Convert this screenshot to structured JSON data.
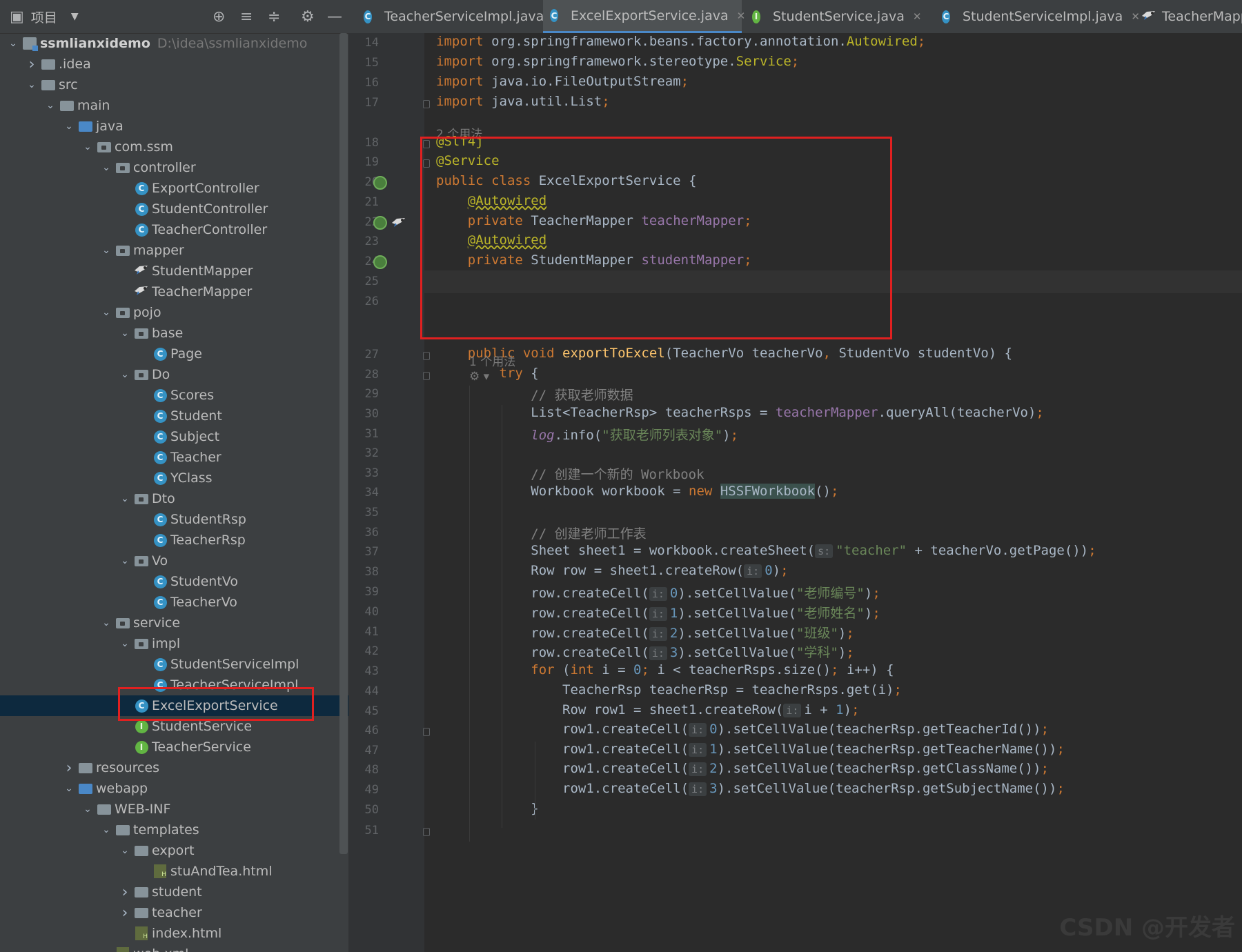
{
  "toolbar": {
    "title": "项目",
    "icons": [
      "locate-icon",
      "expand-all-icon",
      "collapse-all-icon",
      "gear-icon",
      "minimize-icon"
    ]
  },
  "tree": [
    {
      "label": "ssmlianxidemo",
      "hint": "D:\\idea\\ssmlianxidemo",
      "depth": 0,
      "arrow": "down",
      "icon": "project",
      "bold": true
    },
    {
      "label": ".idea",
      "depth": 1,
      "arrow": "right",
      "icon": "folder"
    },
    {
      "label": "src",
      "depth": 1,
      "arrow": "down",
      "icon": "folder"
    },
    {
      "label": "main",
      "depth": 2,
      "arrow": "down",
      "icon": "folder"
    },
    {
      "label": "java",
      "depth": 3,
      "arrow": "down",
      "icon": "folder-blue"
    },
    {
      "label": "com.ssm",
      "depth": 4,
      "arrow": "down",
      "icon": "package"
    },
    {
      "label": "controller",
      "depth": 5,
      "arrow": "down",
      "icon": "package"
    },
    {
      "label": "ExportController",
      "depth": 6,
      "icon": "class"
    },
    {
      "label": "StudentController",
      "depth": 6,
      "icon": "class"
    },
    {
      "label": "TeacherController",
      "depth": 6,
      "icon": "class"
    },
    {
      "label": "mapper",
      "depth": 5,
      "arrow": "down",
      "icon": "package"
    },
    {
      "label": "StudentMapper",
      "depth": 6,
      "icon": "mapper"
    },
    {
      "label": "TeacherMapper",
      "depth": 6,
      "icon": "mapper"
    },
    {
      "label": "pojo",
      "depth": 5,
      "arrow": "down",
      "icon": "package"
    },
    {
      "label": "base",
      "depth": 6,
      "arrow": "down",
      "icon": "package"
    },
    {
      "label": "Page",
      "depth": 7,
      "icon": "class"
    },
    {
      "label": "Do",
      "depth": 6,
      "arrow": "down",
      "icon": "package"
    },
    {
      "label": "Scores",
      "depth": 7,
      "icon": "class"
    },
    {
      "label": "Student",
      "depth": 7,
      "icon": "class"
    },
    {
      "label": "Subject",
      "depth": 7,
      "icon": "class"
    },
    {
      "label": "Teacher",
      "depth": 7,
      "icon": "class"
    },
    {
      "label": "YClass",
      "depth": 7,
      "icon": "class"
    },
    {
      "label": "Dto",
      "depth": 6,
      "arrow": "down",
      "icon": "package"
    },
    {
      "label": "StudentRsp",
      "depth": 7,
      "icon": "class"
    },
    {
      "label": "TeacherRsp",
      "depth": 7,
      "icon": "class"
    },
    {
      "label": "Vo",
      "depth": 6,
      "arrow": "down",
      "icon": "package"
    },
    {
      "label": "StudentVo",
      "depth": 7,
      "icon": "class"
    },
    {
      "label": "TeacherVo",
      "depth": 7,
      "icon": "class"
    },
    {
      "label": "service",
      "depth": 5,
      "arrow": "down",
      "icon": "package"
    },
    {
      "label": "impl",
      "depth": 6,
      "arrow": "down",
      "icon": "package"
    },
    {
      "label": "StudentServiceImpl",
      "depth": 7,
      "icon": "class"
    },
    {
      "label": "TeacherServiceImpl",
      "depth": 7,
      "icon": "class"
    },
    {
      "label": "ExcelExportService",
      "depth": 6,
      "icon": "class",
      "selected": true
    },
    {
      "label": "StudentService",
      "depth": 6,
      "icon": "interface"
    },
    {
      "label": "TeacherService",
      "depth": 6,
      "icon": "interface"
    },
    {
      "label": "resources",
      "depth": 3,
      "arrow": "right",
      "icon": "folder"
    },
    {
      "label": "webapp",
      "depth": 3,
      "arrow": "down",
      "icon": "folder-blue"
    },
    {
      "label": "WEB-INF",
      "depth": 4,
      "arrow": "down",
      "icon": "folder"
    },
    {
      "label": "templates",
      "depth": 5,
      "arrow": "down",
      "icon": "folder"
    },
    {
      "label": "export",
      "depth": 6,
      "arrow": "down",
      "icon": "folder"
    },
    {
      "label": "stuAndTea.html",
      "depth": 7,
      "icon": "html"
    },
    {
      "label": "student",
      "depth": 6,
      "arrow": "right",
      "icon": "folder"
    },
    {
      "label": "teacher",
      "depth": 6,
      "arrow": "right",
      "icon": "folder"
    },
    {
      "label": "index.html",
      "depth": 6,
      "icon": "html"
    },
    {
      "label": "web.xml",
      "depth": 5,
      "icon": "html"
    }
  ],
  "tabs": [
    {
      "label": "TeacherServiceImpl.java",
      "icon": "class"
    },
    {
      "label": "ExcelExportService.java",
      "icon": "class",
      "active": true
    },
    {
      "label": "StudentService.java",
      "icon": "interface"
    },
    {
      "label": "StudentServiceImpl.java",
      "icon": "class"
    },
    {
      "label": "TeacherMapper.java",
      "icon": "mapper"
    }
  ],
  "usages": [
    "2 个用法",
    "1 个用法"
  ],
  "lines": [
    {
      "n": "14",
      "tokens": [
        [
          "kw",
          "import "
        ],
        [
          "",
          "org.springframework.beans.factory.annotation."
        ],
        [
          "ann",
          "Autowired"
        ],
        [
          "kw",
          ";"
        ]
      ]
    },
    {
      "n": "15",
      "tokens": [
        [
          "kw",
          "import "
        ],
        [
          "",
          "org.springframework.stereotype."
        ],
        [
          "ann",
          "Service"
        ],
        [
          "kw",
          ";"
        ]
      ]
    },
    {
      "n": "16",
      "tokens": [
        [
          "kw",
          "import "
        ],
        [
          "",
          "java.io.FileOutputStream"
        ],
        [
          "kw",
          ";"
        ]
      ]
    },
    {
      "n": "17",
      "tokens": [
        [
          "kw",
          "import "
        ],
        [
          "",
          "java.util.List"
        ],
        [
          "kw",
          ";"
        ]
      ]
    },
    {
      "n": "18",
      "tokens": [
        [
          "ann",
          "@Slf4j"
        ]
      ]
    },
    {
      "n": "19",
      "tokens": [
        [
          "ann",
          "@Service"
        ]
      ]
    },
    {
      "n": "20",
      "tokens": [
        [
          "kw",
          "public class "
        ],
        [
          "",
          "ExcelExportService {"
        ]
      ]
    },
    {
      "n": "21",
      "tokens": [
        [
          "",
          "    "
        ],
        [
          "ann wavy",
          "@Autowired"
        ]
      ]
    },
    {
      "n": "22",
      "tokens": [
        [
          "",
          "    "
        ],
        [
          "kw",
          "private "
        ],
        [
          "",
          "TeacherMapper "
        ],
        [
          "fld",
          "teacherMapper"
        ],
        [
          "kw",
          ";"
        ]
      ]
    },
    {
      "n": "23",
      "tokens": [
        [
          "",
          "    "
        ],
        [
          "ann wavy",
          "@Autowired"
        ]
      ]
    },
    {
      "n": "24",
      "tokens": [
        [
          "",
          "    "
        ],
        [
          "kw",
          "private "
        ],
        [
          "",
          "StudentMapper "
        ],
        [
          "fld",
          "studentMapper"
        ],
        [
          "kw",
          ";"
        ]
      ]
    },
    {
      "n": "25",
      "tokens": []
    },
    {
      "n": "26",
      "tokens": []
    },
    {
      "n": "27",
      "tokens": [
        [
          "",
          "    "
        ],
        [
          "kw",
          "public void "
        ],
        [
          "mth",
          "exportToExcel"
        ],
        [
          "",
          "(TeacherVo teacherVo"
        ],
        [
          "kw",
          ", "
        ],
        [
          "",
          "StudentVo studentVo) {"
        ]
      ]
    },
    {
      "n": "28",
      "tokens": [
        [
          "",
          "        "
        ],
        [
          "kw",
          "try "
        ],
        [
          "",
          "{"
        ]
      ]
    },
    {
      "n": "29",
      "tokens": [
        [
          "",
          "            "
        ],
        [
          "cmt",
          "// 获取老师数据"
        ]
      ]
    },
    {
      "n": "30",
      "tokens": [
        [
          "",
          "            List<TeacherRsp> teacherRsps = "
        ],
        [
          "fld",
          "teacherMapper"
        ],
        [
          "",
          ".queryAll(teacherVo)"
        ],
        [
          "kw",
          ";"
        ]
      ]
    },
    {
      "n": "31",
      "tokens": [
        [
          "",
          "            "
        ],
        [
          "fld itl",
          "log"
        ],
        [
          "",
          ".info("
        ],
        [
          "str",
          "\"获取老师列表对象\""
        ],
        [
          "",
          ")"
        ],
        [
          "kw",
          ";"
        ]
      ]
    },
    {
      "n": "32",
      "tokens": []
    },
    {
      "n": "33",
      "tokens": [
        [
          "",
          "            "
        ],
        [
          "cmt",
          "// 创建一个新的 Workbook"
        ]
      ]
    },
    {
      "n": "34",
      "tokens": [
        [
          "",
          "            Workbook workbook = "
        ],
        [
          "kw",
          "new "
        ],
        [
          "hl-bg",
          "HSSFWorkbook"
        ],
        [
          "",
          "()"
        ],
        [
          "kw",
          ";"
        ]
      ]
    },
    {
      "n": "35",
      "tokens": []
    },
    {
      "n": "36",
      "tokens": [
        [
          "",
          "            "
        ],
        [
          "cmt",
          "// 创建老师工作表"
        ]
      ]
    },
    {
      "n": "37",
      "tokens": [
        [
          "",
          "            Sheet sheet1 = workbook.createSheet("
        ],
        [
          "inlay",
          "s:"
        ],
        [
          "str",
          "\"teacher\" "
        ],
        [
          "",
          "+ teacherVo.getPage())"
        ],
        [
          "kw",
          ";"
        ]
      ]
    },
    {
      "n": "38",
      "tokens": [
        [
          "",
          "            Row row = sheet1.createRow("
        ],
        [
          "inlay",
          "i:"
        ],
        [
          "num",
          "0"
        ],
        [
          "",
          ")"
        ],
        [
          "kw",
          ";"
        ]
      ]
    },
    {
      "n": "39",
      "tokens": [
        [
          "",
          "            row.createCell("
        ],
        [
          "inlay",
          "i:"
        ],
        [
          "num",
          "0"
        ],
        [
          "",
          ").setCellValue("
        ],
        [
          "str",
          "\"老师编号\""
        ],
        [
          "",
          ")"
        ],
        [
          "kw",
          ";"
        ]
      ]
    },
    {
      "n": "40",
      "tokens": [
        [
          "",
          "            row.createCell("
        ],
        [
          "inlay",
          "i:"
        ],
        [
          "num",
          "1"
        ],
        [
          "",
          ").setCellValue("
        ],
        [
          "str",
          "\"老师姓名\""
        ],
        [
          "",
          ")"
        ],
        [
          "kw",
          ";"
        ]
      ]
    },
    {
      "n": "41",
      "tokens": [
        [
          "",
          "            row.createCell("
        ],
        [
          "inlay",
          "i:"
        ],
        [
          "num",
          "2"
        ],
        [
          "",
          ").setCellValue("
        ],
        [
          "str",
          "\"班级\""
        ],
        [
          "",
          ")"
        ],
        [
          "kw",
          ";"
        ]
      ]
    },
    {
      "n": "42",
      "tokens": [
        [
          "",
          "            row.createCell("
        ],
        [
          "inlay",
          "i:"
        ],
        [
          "num",
          "3"
        ],
        [
          "",
          ").setCellValue("
        ],
        [
          "str",
          "\"学科\""
        ],
        [
          "",
          ")"
        ],
        [
          "kw",
          ";"
        ]
      ]
    },
    {
      "n": "43",
      "tokens": [
        [
          "",
          "            "
        ],
        [
          "kw",
          "for "
        ],
        [
          "",
          "("
        ],
        [
          "kw",
          "int "
        ],
        [
          "",
          "i = "
        ],
        [
          "num",
          "0"
        ],
        [
          "kw",
          "; "
        ],
        [
          "",
          "i < teacherRsps.size()"
        ],
        [
          "kw",
          "; "
        ],
        [
          "",
          "i++) {"
        ]
      ]
    },
    {
      "n": "44",
      "tokens": [
        [
          "",
          "                TeacherRsp teacherRsp = teacherRsps.get(i)"
        ],
        [
          "kw",
          ";"
        ]
      ]
    },
    {
      "n": "45",
      "tokens": [
        [
          "",
          "                Row row1 = sheet1.createRow("
        ],
        [
          "inlay",
          "i:"
        ],
        [
          "",
          "i + "
        ],
        [
          "num",
          "1"
        ],
        [
          "",
          ")"
        ],
        [
          "kw",
          ";"
        ]
      ]
    },
    {
      "n": "46",
      "tokens": [
        [
          "",
          "                row1.createCell("
        ],
        [
          "inlay",
          "i:"
        ],
        [
          "num",
          "0"
        ],
        [
          "",
          ").setCellValue(teacherRsp.getTeacherId())"
        ],
        [
          "kw",
          ";"
        ]
      ]
    },
    {
      "n": "47",
      "tokens": [
        [
          "",
          "                row1.createCell("
        ],
        [
          "inlay",
          "i:"
        ],
        [
          "num",
          "1"
        ],
        [
          "",
          ").setCellValue(teacherRsp.getTeacherName())"
        ],
        [
          "kw",
          ";"
        ]
      ]
    },
    {
      "n": "48",
      "tokens": [
        [
          "",
          "                row1.createCell("
        ],
        [
          "inlay",
          "i:"
        ],
        [
          "num",
          "2"
        ],
        [
          "",
          ").setCellValue(teacherRsp.getClassName())"
        ],
        [
          "kw",
          ";"
        ]
      ]
    },
    {
      "n": "49",
      "tokens": [
        [
          "",
          "                row1.createCell("
        ],
        [
          "inlay",
          "i:"
        ],
        [
          "num",
          "3"
        ],
        [
          "",
          ").setCellValue(teacherRsp.getSubjectName())"
        ],
        [
          "kw",
          ";"
        ]
      ]
    },
    {
      "n": "50",
      "tokens": [
        [
          "",
          "            }"
        ]
      ]
    },
    {
      "n": "51",
      "tokens": []
    }
  ],
  "watermark": "CSDN @开发者"
}
